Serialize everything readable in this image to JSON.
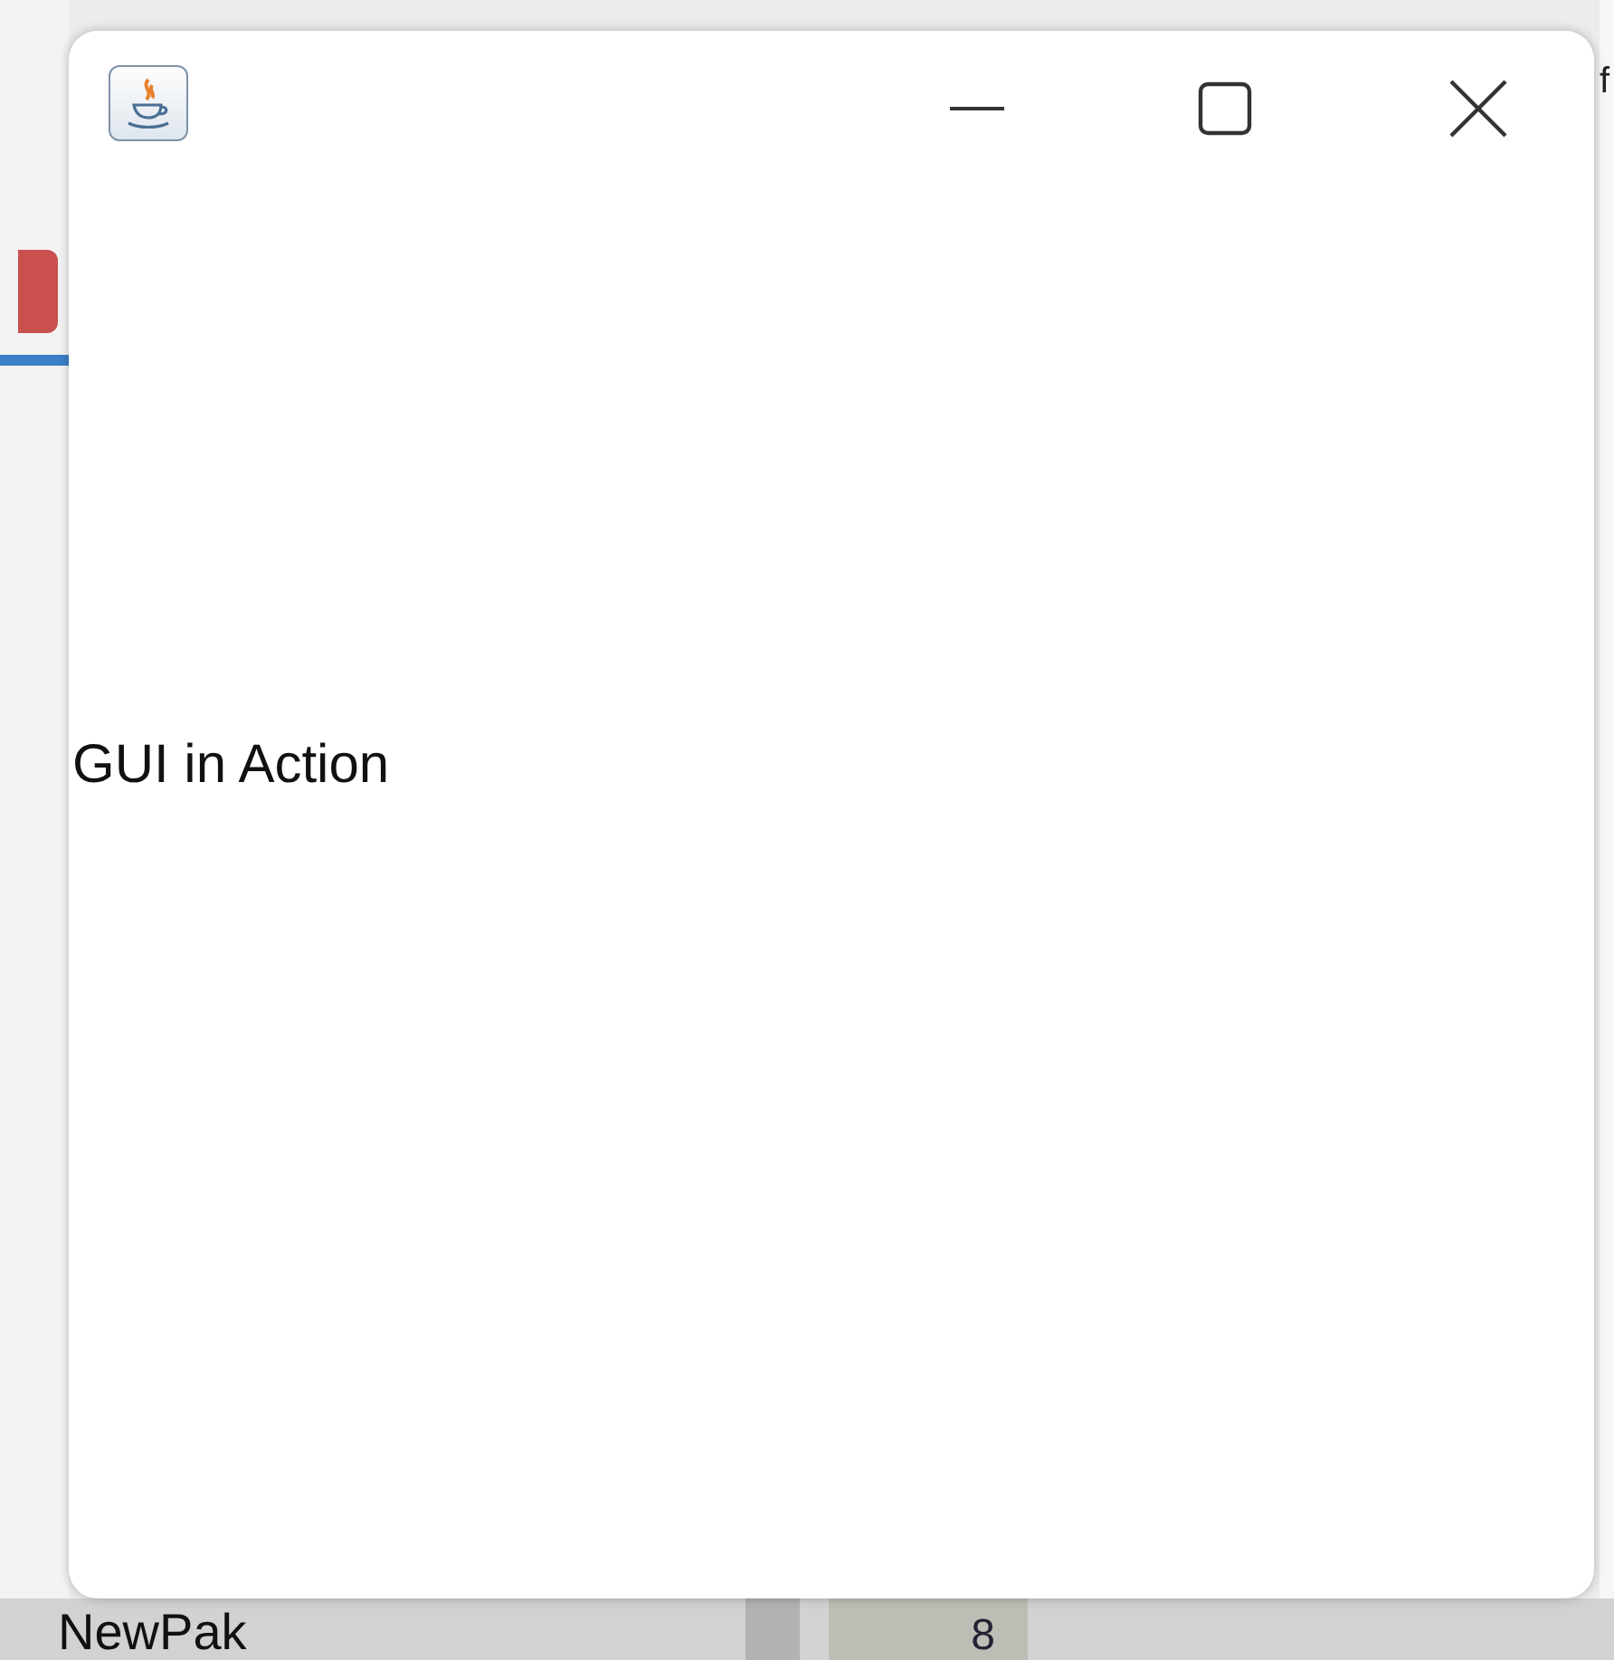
{
  "background_ide": {
    "tree_item": "NewPak",
    "table_cell": "8",
    "editor_text": "f"
  },
  "window": {
    "label": "GUI in Action"
  }
}
